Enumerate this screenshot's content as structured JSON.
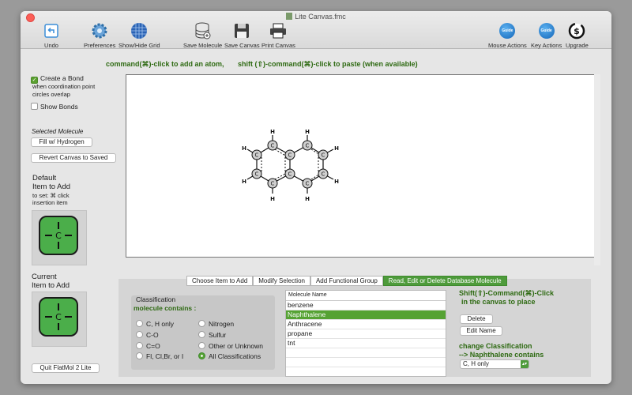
{
  "window": {
    "title": "Lite Canvas.fmc"
  },
  "toolbar": {
    "undo": "Undo",
    "preferences": "Preferences",
    "show_hide_grid": "Show/Hide Grid",
    "save_molecule": "Save Molecule",
    "save_canvas": "Save Canvas",
    "print_canvas": "Print Canvas",
    "mouse_actions": "Mouse Actions",
    "key_actions": "Key Actions",
    "upgrade": "Upgrade",
    "guide_badge": "Guide"
  },
  "hints": {
    "add_atom": "command(⌘)-click to add an atom,",
    "paste": "shift (⇧)-command(⌘)-click to paste (when available)"
  },
  "sidebar": {
    "create_bond": "Create a Bond",
    "create_bond_checked": true,
    "create_bond_note_1": "when coordination point",
    "create_bond_note_2": "circles overlap",
    "show_bonds": "Show Bonds",
    "show_bonds_checked": false,
    "selected_molecule": "Selected Molecule",
    "fill_hydrogen": "Fill w/ Hydrogen",
    "revert_canvas": "Revert Canvas to Saved",
    "default_item_1": "Default",
    "default_item_2": "Item to Add",
    "to_set_1": "to set:  ⌘ click",
    "to_set_2": "insertion item",
    "current_item_1": "Current",
    "current_item_2": "Item to Add",
    "atom_symbol": "C",
    "quit": "Quit FlatMol 2 Lite"
  },
  "molecule": {
    "carbon": "C",
    "hydrogen": "H"
  },
  "tabs": [
    {
      "label": "Choose Item to Add",
      "active": false
    },
    {
      "label": "Modify Selection",
      "active": false
    },
    {
      "label": "Add Functional Group",
      "active": false
    },
    {
      "label": "Read, Edit or Delete Database Molecule",
      "active": true
    }
  ],
  "classification": {
    "title": "Classification",
    "subtitle": "molecule contains :",
    "options": [
      {
        "label": "C, H only",
        "selected": false
      },
      {
        "label": "C-O",
        "selected": false
      },
      {
        "label": "C=O",
        "selected": false
      },
      {
        "label": "Fl, Cl,Br, or I",
        "selected": false
      },
      {
        "label": "Nitrogen",
        "selected": false
      },
      {
        "label": "Sulfur",
        "selected": false
      },
      {
        "label": "Other or Unknown",
        "selected": false
      },
      {
        "label": "All Classifications",
        "selected": true
      }
    ]
  },
  "molecule_list": {
    "header": "Molecule Name",
    "rows": [
      "benzene",
      "Naphthalene",
      "Anthracene",
      "propane",
      "tnt"
    ],
    "selected": "Naphthalene"
  },
  "db_actions": {
    "place_hint_1": "Shift(⇧)-Command(⌘)-Click",
    "place_hint_2": "in the canvas to place",
    "delete": "Delete",
    "edit_name": "Edit Name",
    "change_class_1": "change Classification",
    "change_class_2": "--> Naphthalene contains",
    "class_value": "C, H only"
  },
  "colors": {
    "accent_green": "#4e9b3b",
    "hint_green": "#2e6a12",
    "atom_tile": "#4bae4a"
  }
}
